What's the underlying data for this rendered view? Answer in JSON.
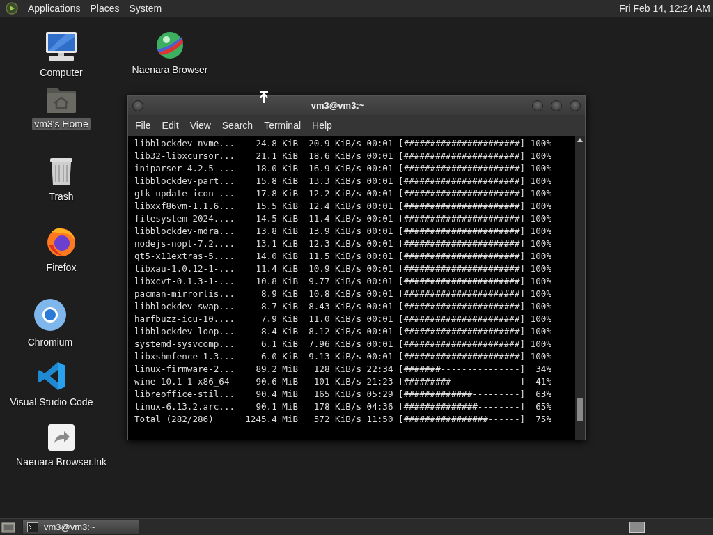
{
  "top_panel": {
    "menus": [
      "Applications",
      "Places",
      "System"
    ],
    "clock": "Fri Feb 14, 12:24 AM"
  },
  "desktop_icons": [
    {
      "kind": "computer",
      "label": "Computer",
      "selected": false
    },
    {
      "kind": "globe",
      "label": "Naenara Browser",
      "selected": false
    },
    {
      "kind": "home",
      "label": "vm3's Home",
      "selected": true
    },
    {
      "kind": "trash",
      "label": "Trash",
      "selected": false
    },
    {
      "kind": "firefox",
      "label": "Firefox",
      "selected": false
    },
    {
      "kind": "chromium",
      "label": "Chromium",
      "selected": false
    },
    {
      "kind": "vscode",
      "label": "Visual Studio Code",
      "selected": false
    },
    {
      "kind": "shortcut",
      "label": "Naenara Browser.lnk",
      "selected": false
    }
  ],
  "terminal": {
    "title": "vm3@vm3:~",
    "menus": [
      "File",
      "Edit",
      "View",
      "Search",
      "Terminal",
      "Help"
    ],
    "lines": [
      "libblockdev-nvme...    24.8 KiB  20.9 KiB/s 00:01 [######################] 100%",
      "lib32-libxcursor...    21.1 KiB  18.6 KiB/s 00:01 [######################] 100%",
      "iniparser-4.2.5-...    18.0 KiB  16.9 KiB/s 00:01 [######################] 100%",
      "libblockdev-part...    15.8 KiB  13.3 KiB/s 00:01 [######################] 100%",
      "gtk-update-icon-...    17.8 KiB  12.2 KiB/s 00:01 [######################] 100%",
      "libxxf86vm-1.1.6...    15.5 KiB  12.4 KiB/s 00:01 [######################] 100%",
      "filesystem-2024....    14.5 KiB  11.4 KiB/s 00:01 [######################] 100%",
      "libblockdev-mdra...    13.8 KiB  13.9 KiB/s 00:01 [######################] 100%",
      "nodejs-nopt-7.2....    13.1 KiB  12.3 KiB/s 00:01 [######################] 100%",
      "qt5-x11extras-5....    14.0 KiB  11.5 KiB/s 00:01 [######################] 100%",
      "libxau-1.0.12-1-...    11.4 KiB  10.9 KiB/s 00:01 [######################] 100%",
      "libxcvt-0.1.3-1-...    10.8 KiB  9.77 KiB/s 00:01 [######################] 100%",
      "pacman-mirrorlis...     8.9 KiB  10.8 KiB/s 00:01 [######################] 100%",
      "libblockdev-swap...     8.7 KiB  8.43 KiB/s 00:01 [######################] 100%",
      "harfbuzz-icu-10....     7.9 KiB  11.0 KiB/s 00:01 [######################] 100%",
      "libblockdev-loop...     8.4 KiB  8.12 KiB/s 00:01 [######################] 100%",
      "systemd-sysvcomp...     6.1 KiB  7.96 KiB/s 00:01 [######################] 100%",
      "libxshmfence-1.3...     6.0 KiB  9.13 KiB/s 00:01 [######################] 100%",
      "linux-firmware-2...    89.2 MiB   128 KiB/s 22:34 [#######---------------]  34%",
      "wine-10.1-1-x86_64     90.6 MiB   101 KiB/s 21:23 [#########-------------]  41%",
      "libreoffice-stil...    90.4 MiB   165 KiB/s 05:29 [#############---------]  63%",
      "linux-6.13.2.arc...    90.1 MiB   178 KiB/s 04:36 [##############--------]  65%",
      "Total (282/286)      1245.4 MiB   572 KiB/s 11:50 [################------]  75%"
    ]
  },
  "taskbar": {
    "tasks": [
      {
        "label": "vm3@vm3:~"
      }
    ]
  }
}
